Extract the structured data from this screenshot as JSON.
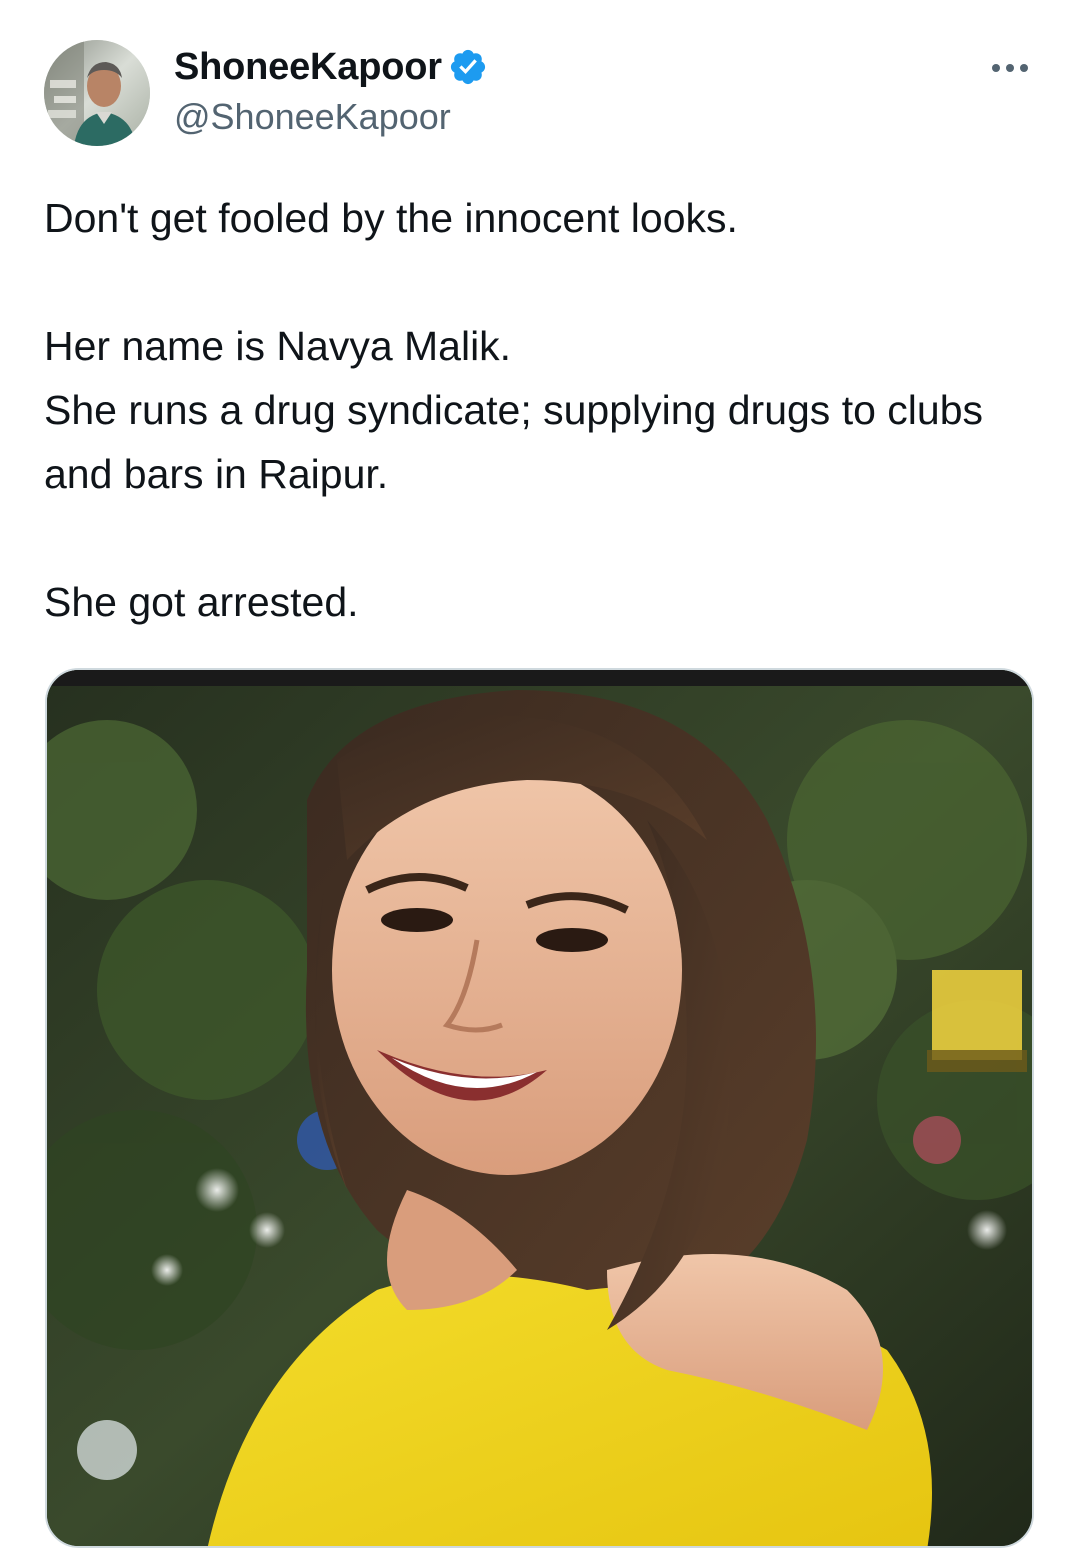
{
  "author": {
    "display_name": "ShoneeKapoor",
    "handle": "@ShoneeKapoor",
    "verified": true,
    "verified_icon": "verified-badge-icon",
    "avatar_icon": "avatar"
  },
  "menu": {
    "icon": "more-horizontal-icon"
  },
  "tweet": {
    "line_1": "Don't get fooled by the innocent looks.",
    "line_2": "Her name is Navya Malik.",
    "line_3": "She runs a drug syndicate; supplying drugs to clubs and bars in Raipur.",
    "line_4": "She got arrested."
  },
  "media": {
    "kind": "photo"
  },
  "colors": {
    "text_primary": "#0f1419",
    "text_secondary": "#536471",
    "verified_blue": "#1d9bf0",
    "border": "#cfd9de"
  }
}
